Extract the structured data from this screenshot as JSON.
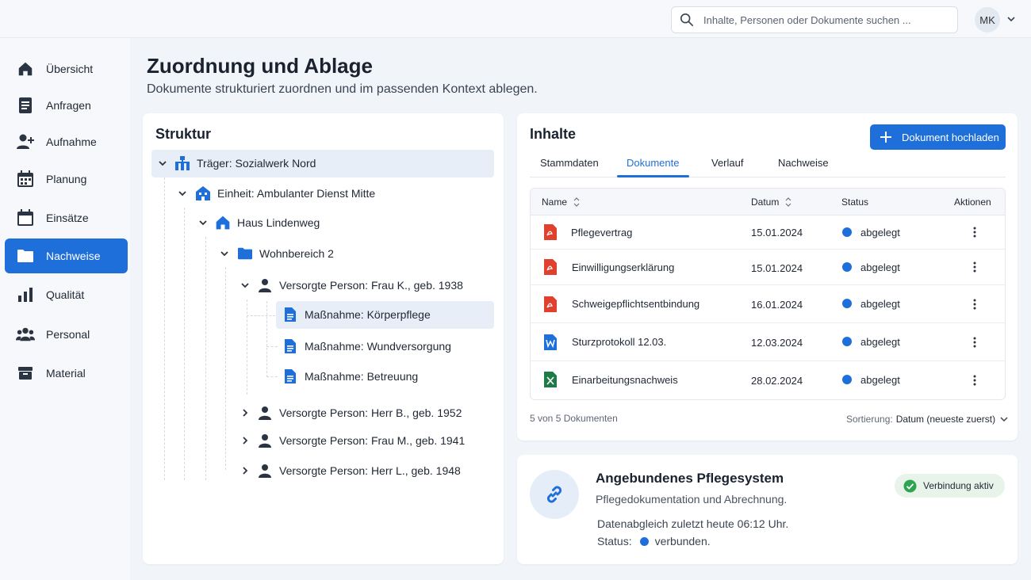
{
  "header": {
    "search_placeholder": "Inhalte, Personen oder Dokumente suchen ...",
    "user_initials": "MK"
  },
  "sidebar": {
    "items": [
      {
        "label": "Übersicht",
        "icon": "home-icon"
      },
      {
        "label": "Anfragen",
        "icon": "document-icon"
      },
      {
        "label": "Aufnahme",
        "icon": "person-add-icon"
      },
      {
        "label": "Planung",
        "icon": "calendar-icon"
      },
      {
        "label": "Einsätze",
        "icon": "calendar-event-icon"
      },
      {
        "label": "Nachweise",
        "icon": "folder-icon",
        "active": true
      },
      {
        "label": "Qualität",
        "icon": "bar-chart-icon"
      },
      {
        "label": "Personal",
        "icon": "people-icon"
      },
      {
        "label": "Material",
        "icon": "inventory-icon"
      }
    ]
  },
  "page": {
    "title": "Zuordnung und Ablage",
    "subtitle": "Dokumente strukturiert zuordnen und im passenden Kontext ablegen."
  },
  "structure": {
    "title": "Struktur",
    "nodes": [
      {
        "label": "Träger: Sozialwerk Nord",
        "icon": "organization-icon",
        "expanded": true,
        "selected": true
      },
      {
        "label": "Einheit: Ambulanter Dienst Mitte",
        "icon": "building-icon",
        "expanded": true
      },
      {
        "label": "Haus Lindenweg",
        "icon": "home-icon",
        "expanded": true
      },
      {
        "label": "Wohnbereich 2",
        "icon": "folder-icon",
        "expanded": true
      },
      {
        "label": "Versorgte Person: Frau K., geb. 1938",
        "icon": "person-icon",
        "expanded": true
      },
      {
        "label": "Maßnahme: Körperpflege",
        "icon": "file-icon",
        "highlighted": true
      },
      {
        "label": "Maßnahme: Wundversorgung",
        "icon": "file-icon"
      },
      {
        "label": "Maßnahme: Betreuung",
        "icon": "file-icon"
      },
      {
        "label": "Versorgte Person: Herr B., geb. 1952",
        "icon": "person-icon",
        "expanded": false
      },
      {
        "label": "Versorgte Person: Frau M., geb. 1941",
        "icon": "person-icon",
        "expanded": false
      },
      {
        "label": "Versorgte Person: Herr L., geb. 1948",
        "icon": "person-icon",
        "expanded": false
      }
    ]
  },
  "contents": {
    "title": "Inhalte",
    "upload_label": "Dokument hochladen",
    "tabs": [
      {
        "label": "Stammdaten"
      },
      {
        "label": "Dokumente",
        "active": true
      },
      {
        "label": "Verlauf"
      },
      {
        "label": "Nachweise"
      }
    ],
    "columns": {
      "name": "Name",
      "date": "Datum",
      "status": "Status",
      "actions": "Aktionen"
    },
    "rows": [
      {
        "name": "Pflegevertrag",
        "date": "15.01.2024",
        "status": "abgelegt",
        "filetype": "pdf"
      },
      {
        "name": "Einwilligungserklärung",
        "date": "15.01.2024",
        "status": "abgelegt",
        "filetype": "pdf"
      },
      {
        "name": "Schweigepflichtsentbindung",
        "date": "16.01.2024",
        "status": "abgelegt",
        "filetype": "pdf"
      },
      {
        "name": "Sturzprotokoll 12.03.",
        "date": "12.03.2024",
        "status": "abgelegt",
        "filetype": "word"
      },
      {
        "name": "Einarbeitungsnachweis",
        "date": "28.02.2024",
        "status": "abgelegt",
        "filetype": "excel"
      }
    ],
    "count_text": "5 von 5 Dokumenten",
    "sort_label": "Sortierung:",
    "sort_value": "Datum (neueste zuerst)"
  },
  "integration": {
    "title": "Angebundenes Pflegesystem",
    "subtitle": "Pflegedokumentation und Abrechnung.",
    "sync_text": "Datenabgleich zuletzt heute 06:12 Uhr.",
    "status_label": "Status:",
    "status_value": "verbunden.",
    "badge": "Verbindung aktiv"
  },
  "colors": {
    "accent": "#1f6fdb",
    "pdf": "#e0412f",
    "word": "#1f6fdb",
    "excel": "#1e7b45",
    "success": "#2ea44f"
  }
}
